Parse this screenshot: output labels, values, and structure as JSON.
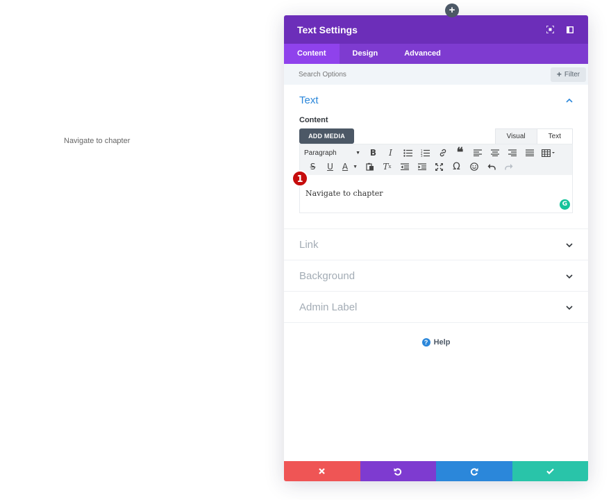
{
  "canvas": {
    "text": "Navigate to chapter"
  },
  "add_button": {
    "label": "+"
  },
  "modal": {
    "title": "Text Settings",
    "tabs": [
      {
        "label": "Content",
        "active": true
      },
      {
        "label": "Design",
        "active": false
      },
      {
        "label": "Advanced",
        "active": false
      }
    ],
    "search": {
      "placeholder": "Search Options",
      "filter_icon": "+",
      "filter_label": "Filter"
    },
    "text_section": {
      "title": "Text",
      "content_label": "Content",
      "add_media_label": "ADD MEDIA",
      "mode_tabs": {
        "visual": "Visual",
        "text": "Text"
      },
      "paragraph_select": "Paragraph",
      "editor_content": "Navigate to chapter",
      "step_badge": "1",
      "grammarly_icon": "G"
    },
    "sections": [
      {
        "title": "Link"
      },
      {
        "title": "Background"
      },
      {
        "title": "Admin Label"
      }
    ],
    "help": {
      "icon": "?",
      "label": "Help"
    }
  },
  "colors": {
    "header": "#6c2eb9",
    "tabs": "#7e3bd0",
    "active_tab": "#8f42ec",
    "accent_blue": "#2b87da",
    "cancel": "#ef5555",
    "undo": "#7e3bd0",
    "redo": "#2b87da",
    "save": "#29c4a9",
    "badge": "#c60c0c"
  }
}
